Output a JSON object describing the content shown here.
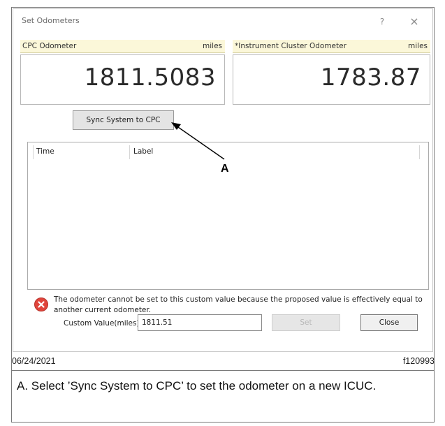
{
  "dialog": {
    "title": "Set Odometers",
    "help_symbol": "?",
    "close_symbol": "×"
  },
  "cpc_odometer": {
    "label": "CPC Odometer",
    "unit": "miles",
    "value": "1811.5083"
  },
  "cluster_odometer": {
    "label": "*Instrument Cluster Odometer",
    "unit": "miles",
    "value": "1783.87"
  },
  "sync_button_label": "Sync System to CPC",
  "log_table": {
    "columns": [
      "Time",
      "Label"
    ],
    "rows": []
  },
  "error": {
    "icon": "error-x-icon",
    "message": "The odometer cannot be set to this custom value because the proposed value is effectively equal to another current odometer."
  },
  "custom_value": {
    "label": "Custom Value(miles):",
    "value": "1811.51"
  },
  "set_button_label": "Set",
  "close_button_label": "Close",
  "callout_letter": "A",
  "figure": {
    "date": "06/24/2021",
    "id": "f120993",
    "caption": "A. Select ’Sync System to CPC’ to set the odometer on a new ICUC."
  },
  "colors": {
    "header_background": "#fbf7d9",
    "error_red": "#e0453c"
  }
}
